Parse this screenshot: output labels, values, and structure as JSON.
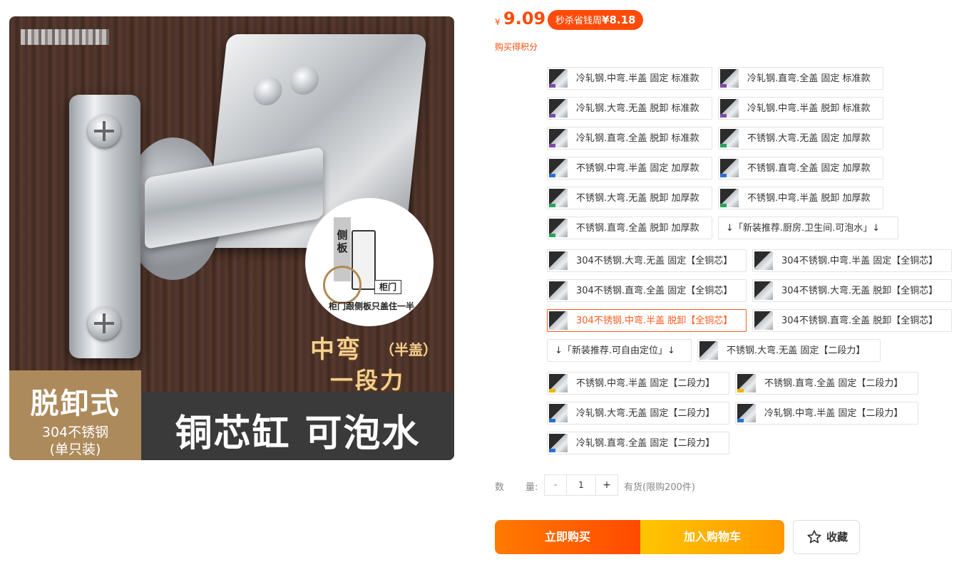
{
  "image": {
    "diagram_side_label": "侧板",
    "diagram_door_label": "柜门",
    "diagram_caption": "柜门跟侧板只盖住一半",
    "bend_title": "中弯",
    "bend_sub": "（半盖）",
    "stage_text": "一段力",
    "badge_line1": "脱卸式",
    "badge_line2": "304不锈钢",
    "badge_line3": "(单只装)",
    "banner_text": "铜芯缸 可泡水"
  },
  "price": {
    "symbol": "¥",
    "value": "9.09"
  },
  "promo": {
    "label": "秒杀省钱周",
    "price": "¥8.18"
  },
  "points_link": "购买得积分",
  "skus": [
    {
      "label": "冷轧钢.中弯.半盖 固定 标准款",
      "thumb": "t-purple"
    },
    {
      "label": "冷轧钢.直弯.全盖 固定 标准款",
      "thumb": "t-purple"
    },
    {
      "label": "冷轧钢.大弯.无盖 脱卸 标准款",
      "thumb": "t-purple"
    },
    {
      "label": "冷轧钢.中弯.半盖 脱卸 标准款",
      "thumb": "t-purple"
    },
    {
      "label": "冷轧钢.直弯.全盖 脱卸 标准款",
      "thumb": "t-purple"
    },
    {
      "label": "不锈钢.大弯.无盖 固定 加厚款",
      "thumb": "t-green"
    },
    {
      "label": "不锈钢.中弯.半盖 固定 加厚款",
      "thumb": "t-blue"
    },
    {
      "label": "不锈钢.直弯.全盖 固定 加厚款",
      "thumb": "t-blue"
    },
    {
      "label": "不锈钢.大弯.无盖 脱卸 加厚款",
      "thumb": "t-green"
    },
    {
      "label": "不锈钢.中弯.半盖 脱卸 加厚款",
      "thumb": "t-green"
    },
    {
      "label": "不锈钢.直弯.全盖 脱卸 加厚款",
      "thumb": "t-green"
    },
    {
      "label": "↓「新装推荐.厨房.卫生间.可泡水」↓",
      "thumb": ""
    },
    {
      "label": "304不锈钢.大弯.无盖 固定【全铜芯】",
      "thumb": "t-none"
    },
    {
      "label": "304不锈钢.中弯.半盖 固定【全铜芯】",
      "thumb": "t-none"
    },
    {
      "label": "304不锈钢.直弯.全盖 固定【全铜芯】",
      "thumb": "t-none"
    },
    {
      "label": "304不锈钢.大弯.无盖 脱卸【全铜芯】",
      "thumb": "t-none"
    },
    {
      "label": "304不锈钢.中弯.半盖 脱卸【全铜芯】",
      "thumb": "t-none",
      "selected": true
    },
    {
      "label": "304不锈钢.直弯.全盖 脱卸【全铜芯】",
      "thumb": "t-none"
    },
    {
      "label": "↓「新装推荐.可自由定位」↓",
      "thumb": ""
    },
    {
      "label": "不锈钢.大弯.无盖 固定【二段力】",
      "thumb": "t-none"
    },
    {
      "label": "不锈钢.中弯.半盖 固定【二段力】",
      "thumb": "t-yellow"
    },
    {
      "label": "不锈钢.直弯.全盖 固定【二段力】",
      "thumb": "t-yellow"
    },
    {
      "label": "冷轧钢.大弯.无盖 固定【二段力】",
      "thumb": "t-blue"
    },
    {
      "label": "冷轧钢.中弯.半盖 固定【二段力】",
      "thumb": "t-blue"
    },
    {
      "label": "冷轧钢.直弯.全盖 固定【二段力】",
      "thumb": "t-blue"
    }
  ],
  "quantity": {
    "label_a": "数",
    "label_b": "量:",
    "minus": "-",
    "value": "1",
    "plus": "+",
    "stock": "有货(限购200件)"
  },
  "actions": {
    "buy_now": "立即购买",
    "add_cart": "加入购物车",
    "favorite": "收藏"
  },
  "colors": {
    "accent": "#ff4b0a",
    "cart": "#ffb300"
  },
  "icons": {
    "favorite": "star-outline-icon"
  }
}
